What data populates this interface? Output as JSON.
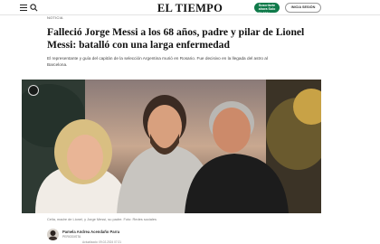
{
  "header": {
    "logo": "EL TIEMPO",
    "subscribe_label": "Suscríbete ahora Solo $9.900/mes",
    "login_label": "INICIA SESIÓN",
    "brand_color": "#0f7a4a"
  },
  "article": {
    "section": "NOTICIA",
    "headline": "Falleció Jorge Messi a los 68 años, padre y pilar de Lionel Messi: batalló con una larga enfermedad",
    "summary": "El representante y guía del capitán de la selección Argentina murió en Rosario. Fue decisivo en la llegada del astro al Barcelona.",
    "photo_caption": "Celia, madre de Lionel, y Jorge Messi, su padre. Foto: Redes sociales",
    "author": {
      "name": "Pamela Andrea Acendaño Parra",
      "role": "PERIODISTA",
      "date": "Actualizado: 09.02.2024 07:21"
    }
  }
}
